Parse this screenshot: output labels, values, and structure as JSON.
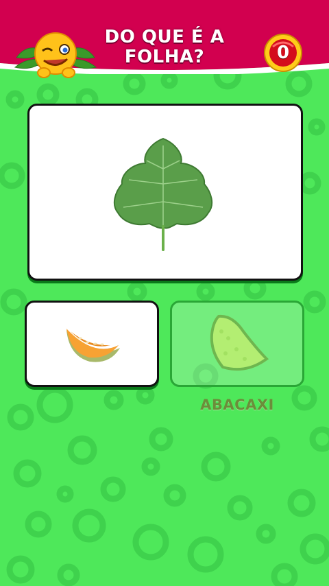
{
  "question": {
    "title": "DO QUE É A FOLHA?"
  },
  "counter": {
    "value": "0"
  },
  "main_image": {
    "icon": "leaf-icon"
  },
  "options": [
    {
      "icon": "melon-slice-icon",
      "label": ""
    },
    {
      "icon": "pineapple-slice-icon",
      "label": "ABACAXI"
    }
  ],
  "colors": {
    "header_bg": "#d2004f",
    "background": "#4ee85a",
    "ring": "#3fd24d",
    "counter_red": "#d40d1c",
    "counter_gold": "#ffcc1a",
    "answer_label": "#6b8e3a"
  }
}
